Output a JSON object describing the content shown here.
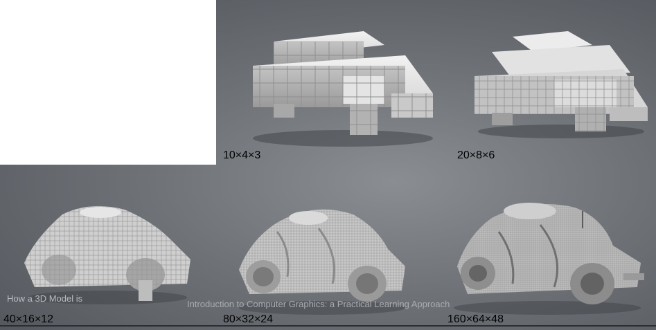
{
  "slide": {
    "ghost_heading_lines": [
      "",
      "",
      "",
      ""
    ],
    "footer_left": "How a 3D Model is",
    "footer_center": "Introduction to Computer Graphics: a Practical Learning Approach"
  },
  "panels": [
    {
      "caption": "10×4×3",
      "icon": "voxel-car-10x4x3"
    },
    {
      "caption": "20×8×6",
      "icon": "voxel-car-20x8x6"
    },
    {
      "caption": "40×16×12",
      "icon": "voxel-car-40x16x12"
    },
    {
      "caption": "80×32×24",
      "icon": "voxel-car-80x32x24"
    },
    {
      "caption": "160×64×48",
      "icon": "voxel-car-160x64x48"
    }
  ]
}
